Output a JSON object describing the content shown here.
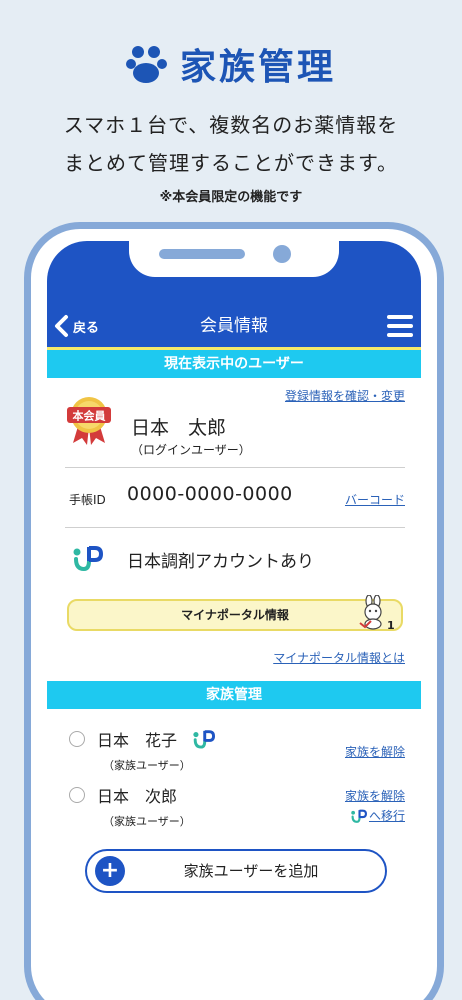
{
  "hero": {
    "title": "家族管理",
    "desc_line1": "スマホ１台で、複数名のお薬情報を",
    "desc_line2": "まとめて管理することができます。",
    "note": "※本会員限定の機能です"
  },
  "navbar": {
    "back_label": "戻る",
    "title": "会員情報"
  },
  "current_user": {
    "section_label": "現在表示中のユーザー",
    "edit_link": "登録情報を確認・変更",
    "badge_label": "本会員",
    "name": "日本　太郎",
    "sub": "（ログインユーザー）",
    "techo_label": "手帳ID",
    "techo_id": "0000-0000-0000",
    "barcode_link": "バーコード",
    "account_text": "日本調剤アカウントあり",
    "mina_label": "マイナポータル情報",
    "mina_link": "マイナポータル情報とは"
  },
  "family": {
    "section_label": "家族管理",
    "members": [
      {
        "name": "日本　花子",
        "sub": "（家族ユーザー）",
        "action": "家族を解除"
      },
      {
        "name": "日本　次郎",
        "sub": "（家族ユーザー）",
        "action": "家族を解除",
        "migrate": "へ移行"
      }
    ],
    "add_label": "家族ユーザーを追加"
  },
  "colors": {
    "brand_blue": "#1e54c4",
    "section_cyan": "#1ec9f0",
    "hero_blue": "#1d55b5",
    "logo_green": "#2fb8a3"
  }
}
